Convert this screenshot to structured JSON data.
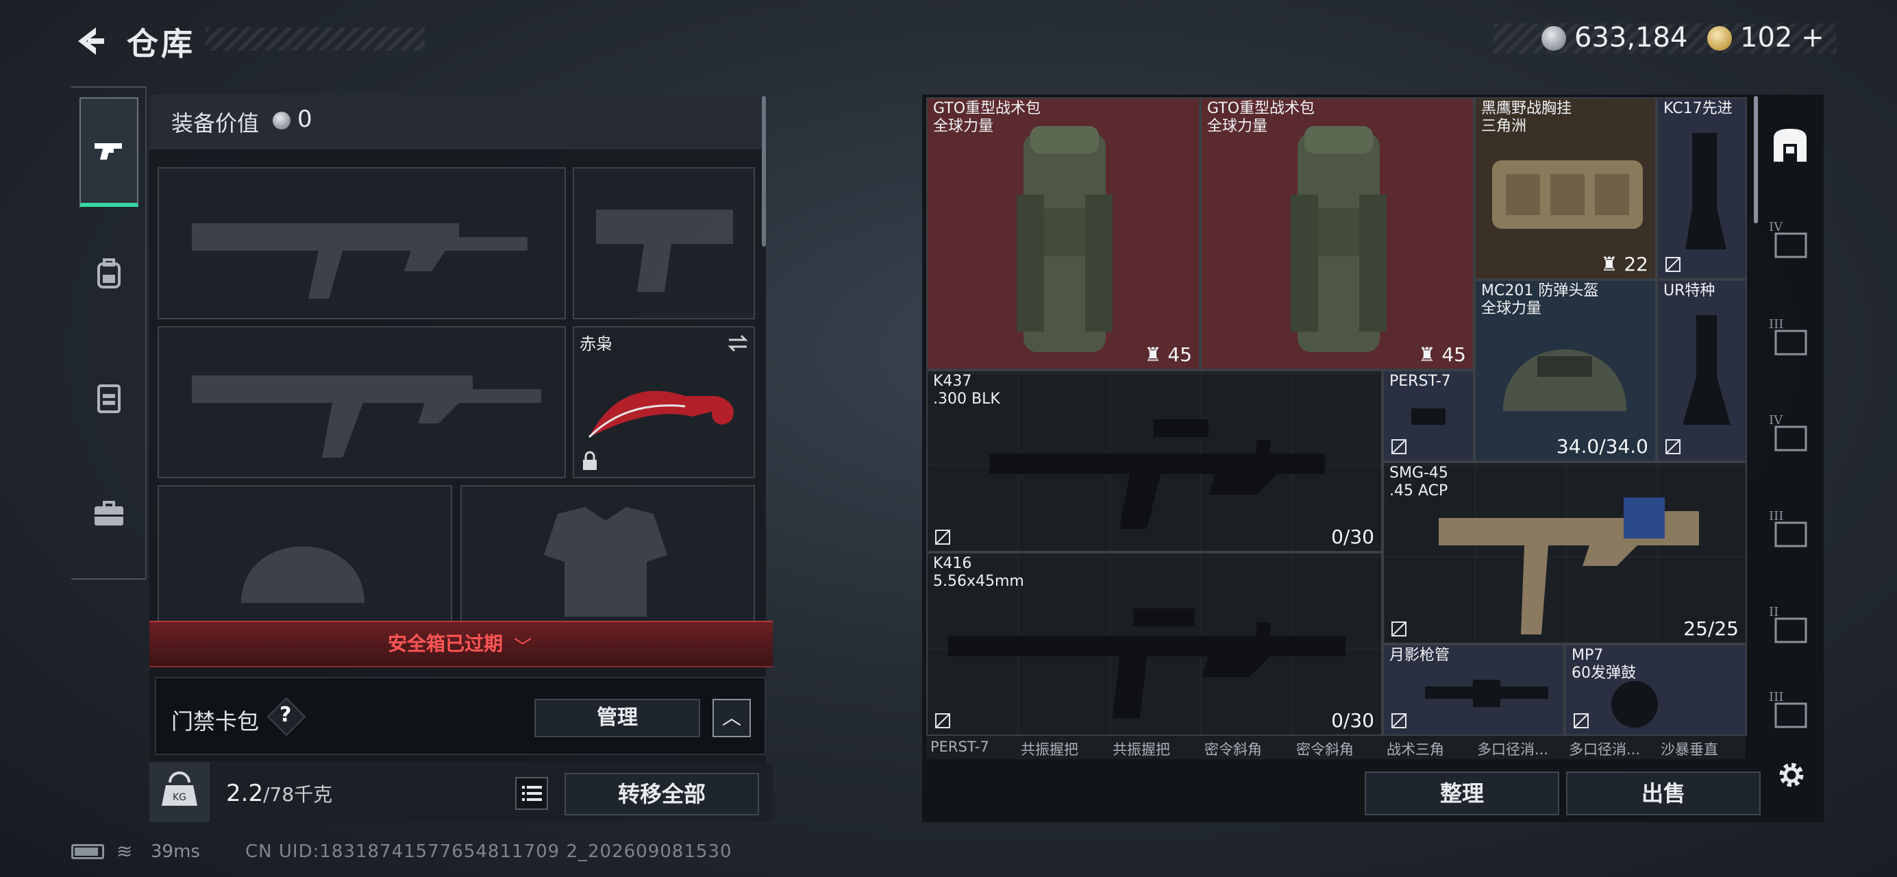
{
  "header": {
    "title": "仓库",
    "currency_silver": "633,184",
    "currency_gold": "102",
    "currency_plus": "+"
  },
  "left_rail": {
    "items": [
      {
        "icon": "pistol-icon",
        "active": true
      },
      {
        "icon": "backpack-icon",
        "active": false
      },
      {
        "icon": "vest-icon",
        "active": false
      },
      {
        "icon": "briefcase-icon",
        "active": false
      }
    ]
  },
  "loadout": {
    "value_label": "装备价值",
    "value": "0",
    "knife_name": "赤枭",
    "expired_banner": "安全箱已过期",
    "card_pack_label": "门禁卡包",
    "help": "?",
    "manage_button": "管理",
    "weight_current": "2.2",
    "weight_max": "/78千克",
    "transfer_all_button": "转移全部"
  },
  "status": {
    "ping": "39ms",
    "uid": "CN UID:18318741577654811709 2_202609081530"
  },
  "stash": {
    "items": [
      {
        "name": "GTO重型战术包",
        "sub": "全球力量",
        "count": "45"
      },
      {
        "name": "GTO重型战术包",
        "sub": "全球力量",
        "count": "45"
      },
      {
        "name": "黑鹰野战胸挂",
        "sub": "三角洲",
        "count": "22"
      },
      {
        "name": "KC17先进",
        "sub": ""
      },
      {
        "name": "MC201 防弹头盔",
        "sub": "全球力量",
        "durability": "34.0/34.0"
      },
      {
        "name": "UR特种",
        "sub": ""
      },
      {
        "name": "K437",
        "sub": ".300 BLK",
        "ammo": "0/30"
      },
      {
        "name": "PERST-7",
        "sub": ""
      },
      {
        "name": "SMG-45",
        "sub": ".45 ACP",
        "ammo": "25/25"
      },
      {
        "name": "K416",
        "sub": "5.56x45mm",
        "ammo": "0/30"
      },
      {
        "name": "月影枪管",
        "sub": ""
      },
      {
        "name": "MP7",
        "sub": "60发弹鼓"
      }
    ],
    "peek_row": [
      "PERST-7",
      "共振握把",
      "共振握把",
      "密令斜角",
      "密令斜角",
      "战术三角",
      "多口径消...",
      "多口径消...",
      "沙暴垂直"
    ],
    "sort_button": "整理",
    "sell_button": "出售"
  },
  "right_tabs": [
    "IV",
    "III",
    "IV",
    "III",
    "II",
    "III"
  ]
}
